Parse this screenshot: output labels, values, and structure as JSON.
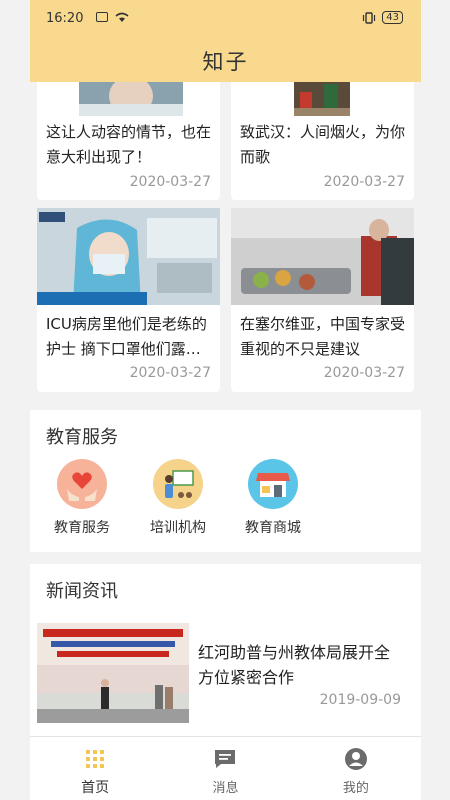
{
  "status": {
    "time": "16:20",
    "battery": "43"
  },
  "header": {
    "title": "知子"
  },
  "articles": [
    {
      "title": "这让人动容的情节，也在意大利出现了！",
      "date": "2020-03-27"
    },
    {
      "title": "致武汉：人间烟火，为你而歌",
      "date": "2020-03-27"
    },
    {
      "title": "ICU病房里他们是老练的护士 摘下口罩他们露…",
      "date": "2020-03-27"
    },
    {
      "title": "在塞尔维亚，中国专家受重视的不只是建议",
      "date": "2020-03-27"
    }
  ],
  "education": {
    "title": "教育服务",
    "items": [
      {
        "label": "教育服务",
        "icon": "hands-heart-icon",
        "color": "#f6b39a"
      },
      {
        "label": "培训机构",
        "icon": "teacher-board-icon",
        "color": "#f6d38a"
      },
      {
        "label": "教育商城",
        "icon": "store-icon",
        "color": "#5bc5e8"
      }
    ]
  },
  "news": {
    "title": "新闻资讯",
    "items": [
      {
        "title": "红河助普与州教体局展开全方位紧密合作",
        "date": "2019-09-09"
      }
    ]
  },
  "tabbar": [
    {
      "label": "首页",
      "icon": "grid-icon",
      "active": true
    },
    {
      "label": "消息",
      "icon": "message-icon",
      "active": false
    },
    {
      "label": "我的",
      "icon": "user-icon",
      "active": false
    }
  ],
  "colors": {
    "header": "#f9d98e",
    "accent": "#f6c453"
  }
}
